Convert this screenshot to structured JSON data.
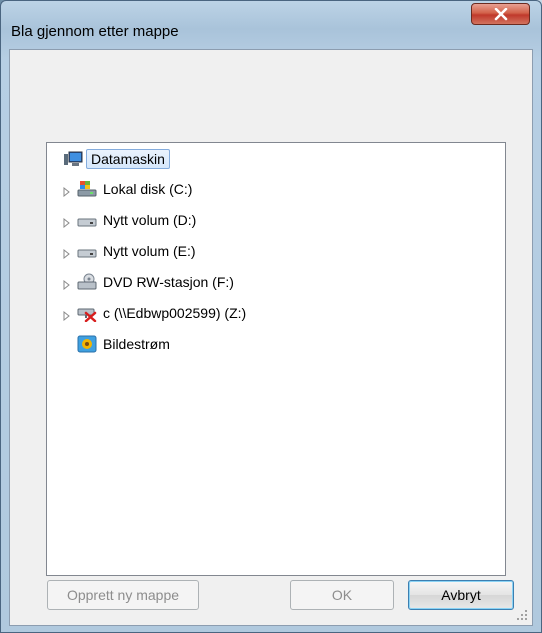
{
  "window": {
    "title": "Bla gjennom etter mappe"
  },
  "tree": {
    "root": {
      "label": "Datamaskin",
      "icon": "computer-icon",
      "selected": true
    },
    "items": [
      {
        "label": "Lokal disk (C:)",
        "icon": "system-drive-icon"
      },
      {
        "label": "Nytt volum (D:)",
        "icon": "drive-icon"
      },
      {
        "label": "Nytt volum (E:)",
        "icon": "drive-icon"
      },
      {
        "label": "DVD RW-stasjon (F:)",
        "icon": "dvd-drive-icon"
      },
      {
        "label": "c (\\\\Edbwp002599) (Z:)",
        "icon": "disconnected-network-drive-icon"
      },
      {
        "label": "Bildestrøm",
        "icon": "photostream-icon"
      }
    ]
  },
  "buttons": {
    "new_folder": "Opprett ny mappe",
    "ok": "OK",
    "cancel": "Avbryt"
  },
  "colors": {
    "selection_border": "#84acdd",
    "close_button": "#c0392b",
    "frame": "#b0c9de"
  }
}
